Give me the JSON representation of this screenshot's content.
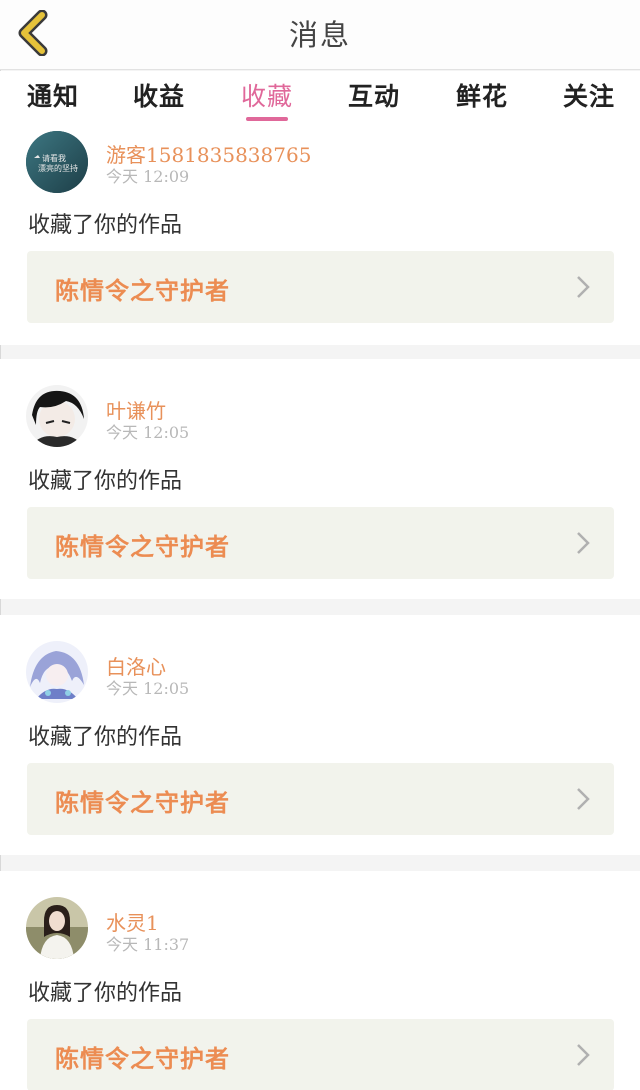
{
  "header": {
    "title": "消息",
    "back_icon": "chevron-left-icon"
  },
  "tabs": [
    {
      "label": "通知",
      "active": false
    },
    {
      "label": "收益",
      "active": false
    },
    {
      "label": "收藏",
      "active": true
    },
    {
      "label": "互动",
      "active": false
    },
    {
      "label": "鲜花",
      "active": false
    },
    {
      "label": "关注",
      "active": false
    }
  ],
  "notifications": [
    {
      "username": "游客1581835838765",
      "time": "今天  12:09",
      "action": "收藏了你的作品",
      "work_title": "陈情令之守护者",
      "avatar": {
        "kind": "text-card",
        "lines": [
          "请看我",
          "漂亮的坚持"
        ]
      }
    },
    {
      "username": "叶谦竹",
      "time": "今天  12:05",
      "action": "收藏了你的作品",
      "work_title": "陈情令之守护者",
      "avatar": {
        "kind": "anime-boy"
      }
    },
    {
      "username": "白洛心",
      "time": "今天  12:05",
      "action": "收藏了你的作品",
      "work_title": "陈情令之守护者",
      "avatar": {
        "kind": "anime-girl"
      }
    },
    {
      "username": "水灵1",
      "time": "今天  11:37",
      "action": "收藏了你的作品",
      "work_title": "陈情令之守护者",
      "avatar": {
        "kind": "photo-woman"
      }
    }
  ],
  "colors": {
    "accent_pink": "#e0689a",
    "username_orange": "#e8915a",
    "work_title_orange": "#ec8c52",
    "back_icon_yellow": "#e5c23a"
  }
}
